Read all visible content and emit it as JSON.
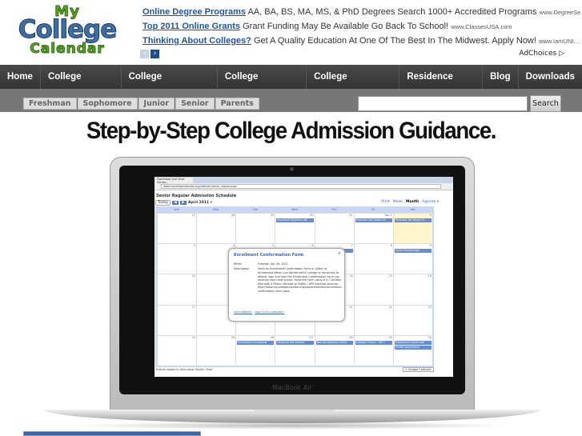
{
  "logo": {
    "line1": "My",
    "line2": "College",
    "line3": "Calendar"
  },
  "ads": [
    {
      "title": "Online Degree Programs",
      "text": "AA, BA, BS, MA, MS, & PhD Degrees Search 1000+ Accredited Programs",
      "url": "www.DegreeSe..."
    },
    {
      "title": "Top 2011 Online Grants",
      "text": "Grant Funding May Be Available Go Back To School!",
      "url": "www.ClassesUSA.com"
    },
    {
      "title": "Thinking About Colleges?",
      "text": "Get A Quality Education At One Of The Best In The Midwest. Apply Now!",
      "url": "www.IamUNI...."
    }
  ],
  "ad_nav": {
    "prev": "‹",
    "next": "›"
  },
  "adchoices": "AdChoices ▷",
  "nav": [
    "Home",
    "College Search",
    "College Admission",
    "College Calendar",
    "College Financing",
    "Residence Prep",
    "Blog",
    "Downloads"
  ],
  "subnav": [
    "Freshman",
    "Sophomore",
    "Junior",
    "Senior",
    "Parents"
  ],
  "search": {
    "value": "",
    "button": "Search"
  },
  "headline": "Step-by-Step College Admission Guidance.",
  "laptop_label": "MacBook Air",
  "browser": {
    "tab": "Download and View Senior...",
    "url": "www.mycollegecalendar.org/calendar/senior_regular.aspx"
  },
  "calendar": {
    "title": "Senior Regular Admission Schedule",
    "today": "Today",
    "prev": "◀",
    "next": "▶",
    "month": "April 2011 ▾",
    "views": [
      "Print",
      "Week",
      "Month",
      "Agenda ▾"
    ],
    "days": [
      "Sun",
      "Mon",
      "Tue",
      "Wed",
      "Thu",
      "Fri",
      "Sat"
    ],
    "weeks": [
      {
        "dates": [
          "27",
          "28",
          "29",
          "30",
          "31",
          "Apr 1",
          "2"
        ],
        "events": [
          null,
          null,
          null,
          [
            "Accepted Students We"
          ],
          null,
          [
            "Financial Aid Award Le"
          ],
          [
            "Financial Aid Issues To"
          ]
        ]
      },
      {
        "dates": [
          "3",
          "4",
          "5",
          "6",
          "7",
          "8",
          "9"
        ],
        "events": [
          null,
          null,
          null,
          null,
          [
            "al A"
          ],
          null,
          [
            "Local Scholarships"
          ]
        ]
      },
      {
        "dates": [
          "10",
          "11",
          "12",
          "13",
          "14",
          "15",
          "16"
        ],
        "events": [
          null,
          null,
          null,
          null,
          null,
          null,
          null
        ]
      },
      {
        "dates": [
          "17",
          "18",
          "19",
          "20",
          "21",
          "22",
          "23"
        ],
        "events": [
          null,
          null,
          null,
          null,
          null,
          null,
          null
        ]
      },
      {
        "dates": [
          "24",
          "25",
          "26",
          "27",
          "28",
          "29",
          "30"
        ],
        "events": [
          null,
          null,
          [
            "Enrollment Conformat"
          ],
          [
            "Financial Aid Awards -"
          ],
          [
            "Non-Acceptance Letter"
          ],
          [
            "College Choice - Tell Y"
          ],
          [
            "Enrollment Confirmati",
            "Grade Importance"
          ]
        ]
      }
    ],
    "timezone": "Events shown in time zone: Pacific Time",
    "gcal": "+ Google Calendar",
    "popup": {
      "title": "Enrollment Conformation Form",
      "when_label": "When",
      "when": "Tuesday, Apr 26, 2011",
      "desc_label": "Description",
      "desc": "Send an Enrollment Confirmation Form or Letter of Acceptance.When you decide which college or university to attend, sign and mail the Enrollment Confirmation Form you received from that school. Send the Form using U.S. Certified Mail with a Return Receipt or FedEx / UPS tracking services. http://www.mycollegecalendar.org/explore/seniors/enrollment-confirmation-form.aspx",
      "link1": "more details»",
      "link2": "copy to my calendar»",
      "close": "×"
    }
  },
  "colors": {
    "nav_bg": "#3c3c3c",
    "subnav_bg": "#777777",
    "link": "#1f56a3",
    "event": "#668cd9",
    "logo_blue": "#3c6ea8",
    "logo_green": "#5aa52a"
  }
}
